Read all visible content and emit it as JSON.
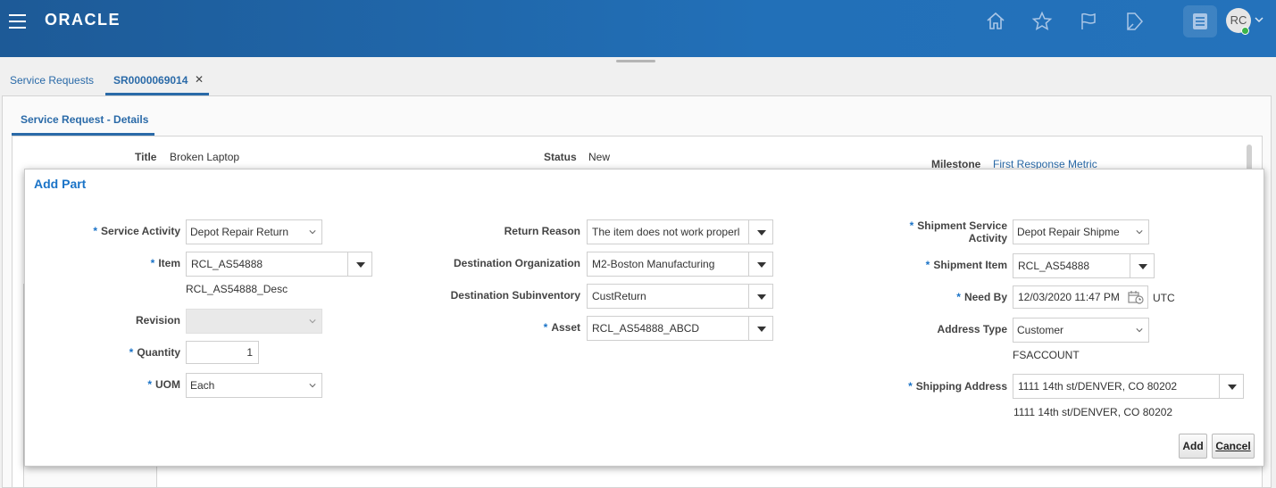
{
  "header": {
    "brand": "ORACLE",
    "avatar_initials": "RC"
  },
  "tabs": [
    {
      "label": "Service Requests"
    },
    {
      "label": "SR0000069014"
    }
  ],
  "subtab": "Service Request - Details",
  "background": {
    "title_label": "Title",
    "title_value": "Broken Laptop",
    "status_label": "Status",
    "status_value": "New",
    "milestone_label": "Milestone",
    "milestone_value": "First Response Metric"
  },
  "dialog": {
    "title": "Add Part",
    "service_activity": {
      "label": "Service Activity",
      "value": "Depot Repair Return"
    },
    "item": {
      "label": "Item",
      "value": "RCL_AS54888",
      "desc": "RCL_AS54888_Desc"
    },
    "revision": {
      "label": "Revision",
      "value": ""
    },
    "quantity": {
      "label": "Quantity",
      "value": "1"
    },
    "uom": {
      "label": "UOM",
      "value": "Each"
    },
    "return_reason": {
      "label": "Return Reason",
      "value": "The item does not work properl"
    },
    "destination_org": {
      "label": "Destination Organization",
      "value": "M2-Boston Manufacturing"
    },
    "destination_subinv": {
      "label": "Destination Subinventory",
      "value": "CustReturn"
    },
    "asset": {
      "label": "Asset",
      "value": "RCL_AS54888_ABCD"
    },
    "shipment_service_activity": {
      "label_line1": "Shipment Service",
      "label_line2": "Activity",
      "value": "Depot Repair Shipme"
    },
    "shipment_item": {
      "label": "Shipment Item",
      "value": "RCL_AS54888"
    },
    "need_by": {
      "label": "Need By",
      "value": "12/03/2020 11:47 PM",
      "tz": "UTC"
    },
    "address_type": {
      "label": "Address Type",
      "value": "Customer",
      "account": "FSACCOUNT"
    },
    "shipping_address": {
      "label": "Shipping Address",
      "value": "1111 14th st/DENVER, CO 80202",
      "display": "1111 14th st/DENVER, CO 80202"
    },
    "add_button": "Add",
    "cancel_button": "Cancel"
  }
}
